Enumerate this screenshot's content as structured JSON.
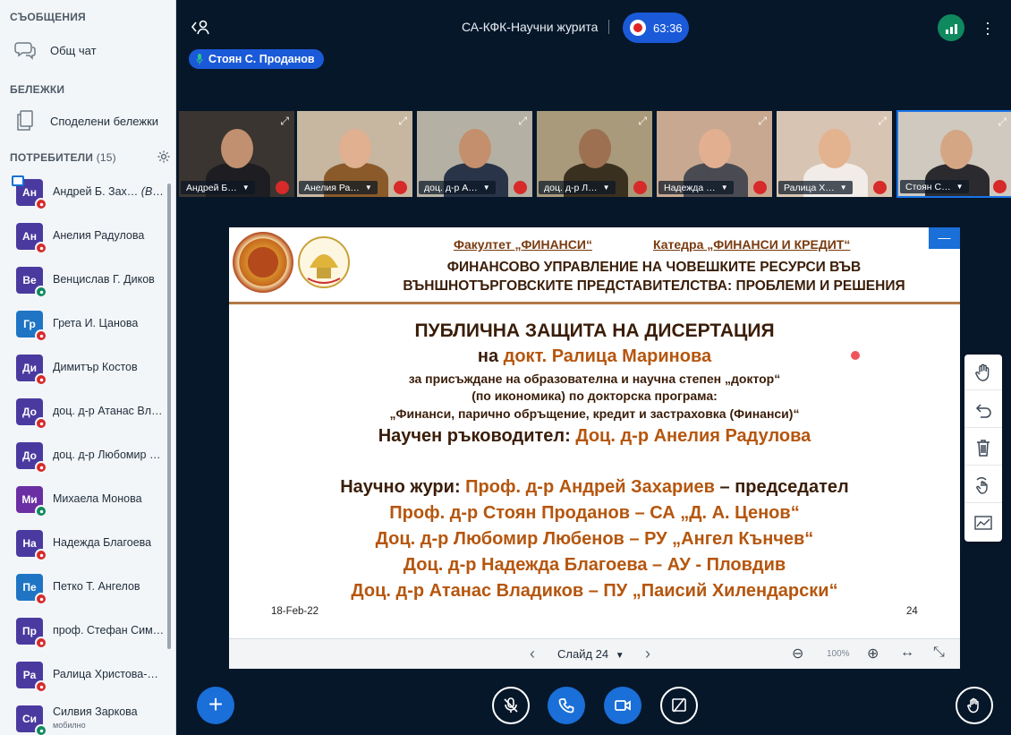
{
  "sidebar": {
    "messages_title": "СЪОБЩЕНИЯ",
    "public_chat": "Общ чат",
    "notes_title": "БЕЛЕЖКИ",
    "shared_notes": "Споделени бележки",
    "users_title": "ПОТРЕБИТЕЛИ",
    "users_count": "(15)",
    "users": [
      {
        "initials": "Ан",
        "name": "Андрей Б. Зах…",
        "you": "(Вие)",
        "status": "muted",
        "color": "#4a3aa0"
      },
      {
        "initials": "Ан",
        "name": "Анелия Радулова",
        "status": "muted",
        "color": "#4a3aa0"
      },
      {
        "initials": "Ве",
        "name": "Венцислав Г. Диков",
        "status": "listen",
        "color": "#4a3aa0"
      },
      {
        "initials": "Гр",
        "name": "Грета И. Цанова",
        "status": "muted",
        "color": "#1f75c4"
      },
      {
        "initials": "Ди",
        "name": "Димитър Костов",
        "status": "muted",
        "color": "#4a3aa0"
      },
      {
        "initials": "До",
        "name": "доц. д-р Атанас Вла…",
        "status": "muted",
        "color": "#4a3aa0"
      },
      {
        "initials": "До",
        "name": "доц. д-р Любомир Л…",
        "status": "muted",
        "color": "#4a3aa0"
      },
      {
        "initials": "Ми",
        "name": "Михаела Монова",
        "status": "listen",
        "color": "#6b2fa3"
      },
      {
        "initials": "На",
        "name": "Надежда Благоева",
        "status": "muted",
        "color": "#4a3aa0"
      },
      {
        "initials": "Пе",
        "name": "Петко Т. Ангелов",
        "status": "muted",
        "color": "#1f75c4"
      },
      {
        "initials": "Пр",
        "name": "проф. Стефан Сим…",
        "status": "muted",
        "color": "#4a3aa0"
      },
      {
        "initials": "Ра",
        "name": "Ралица Христова-М…",
        "status": "muted",
        "color": "#4a3aa0"
      },
      {
        "initials": "Си",
        "name": "Силвия Заркова",
        "sub": "мобилно",
        "status": "listen",
        "color": "#4a3aa0"
      }
    ]
  },
  "header": {
    "title": "СА-КФК-Научни журита",
    "record_time": "63:36",
    "talking": "Стоян С. Проданов"
  },
  "videos": [
    {
      "label": "Андрей Б…",
      "bg": "#3a3530",
      "face": "#c09070",
      "shirt": "#1e1e22"
    },
    {
      "label": "Анелия Ра…",
      "bg": "#c7b6a0",
      "face": "#e0b090",
      "shirt": "#8a5a2a"
    },
    {
      "label": "доц. д-р А…",
      "bg": "#b5b0a4",
      "face": "#c48f6c",
      "shirt": "#2a3448"
    },
    {
      "label": "доц. д-р Л…",
      "bg": "#a89a7a",
      "face": "#9c7050",
      "shirt": "#3a3020"
    },
    {
      "label": "Надежда …",
      "bg": "#c8a890",
      "face": "#e2b090",
      "shirt": "#4a4a52"
    },
    {
      "label": "Ралица Х…",
      "bg": "#d8c4b2",
      "face": "#e3b28e",
      "shirt": "#f1ece8"
    },
    {
      "label": "Стоян С…",
      "bg": "#cfc9bf",
      "face": "#d5a684",
      "shirt": "#2b2b2f"
    }
  ],
  "slide": {
    "faculty": "Факултет „ФИНАНСИ“",
    "department": "Катедра „ФИНАНСИ И КРЕДИТ“",
    "topic_line1": "ФИНАНСОВО УПРАВЛЕНИЕ НА ЧОВЕШКИТЕ РЕСУРСИ ВЪВ",
    "topic_line2": "ВЪНШНОТЪРГОВСКИТЕ ПРЕДСТАВИТЕЛСТВА: ПРОБЛЕМИ И РЕШЕНИЯ",
    "heading": "ПУБЛИЧНА ЗАЩИТА НА ДИСЕРТАЦИЯ",
    "on_prefix": "на",
    "candidate": "докт. Ралица Маринова",
    "line_award": "за присъждане на образователна и научна степен „доктор“",
    "line_program": "(по икономика) по докторска програма:",
    "line_program_name": "„Финанси, парично обръщение, кредит и застраховка (Финанси)“",
    "supervisor_label": "Научен ръководител:",
    "supervisor": "Доц. д-р Анелия Радулова",
    "jury_label": "Научно жури:",
    "jury_chair": "Проф. д-р Андрей Захариев",
    "jury_chair_role": "– председател",
    "jury": [
      "Проф. д-р Стоян Проданов – СА „Д. А. Ценов“",
      "Доц. д-р Любомир Любенов – РУ „Ангел Кънчев“",
      "Доц. д-р Надежда Благоева – АУ - Пловдив",
      "Доц. д-р Атанас Владиков – ПУ „Паисий Хилендарски“"
    ],
    "date": "18-Feb-22",
    "page": "24"
  },
  "slide_controls": {
    "slide_label": "Слайд 24",
    "zoom": "100%"
  }
}
